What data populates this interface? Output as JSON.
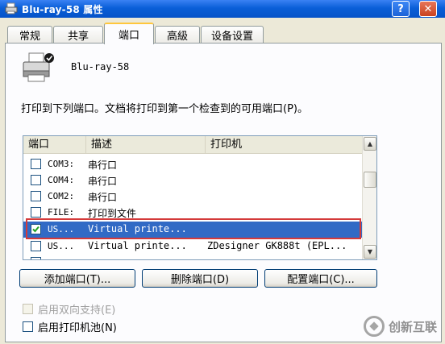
{
  "window": {
    "title": "Blu-ray-58 属性",
    "help": "?",
    "close": "✕"
  },
  "tabs": [
    {
      "label": "常规"
    },
    {
      "label": "共享"
    },
    {
      "label": "端口"
    },
    {
      "label": "高級"
    },
    {
      "label": "设备设置"
    }
  ],
  "printer_name": "Blu-ray-58",
  "instruction": "打印到下列端口。文档将打印到第一个检查到的可用端口(P)。",
  "list": {
    "headers": {
      "port": "端口",
      "desc": "描述",
      "printer": "打印机"
    },
    "rows": [
      {
        "port": "COM3:",
        "desc": "串行口",
        "printer": "",
        "checked": false
      },
      {
        "port": "COM4:",
        "desc": "串行口",
        "printer": "",
        "checked": false
      },
      {
        "port": "COM2:",
        "desc": "串行口",
        "printer": "",
        "checked": false
      },
      {
        "port": "FILE:",
        "desc": "打印到文件",
        "printer": "",
        "checked": false
      },
      {
        "port": "US...",
        "desc": "Virtual printe...",
        "printer": "",
        "checked": true
      },
      {
        "port": "US...",
        "desc": "Virtual printe...",
        "printer": "ZDesigner GK888t (EPL...",
        "checked": false
      }
    ]
  },
  "buttons": {
    "add": "添加端口(T)...",
    "delete": "删除端口(D)",
    "configure": "配置端口(C)..."
  },
  "options": {
    "bidirectional": "启用双向支持(E)",
    "pooling": "启用打印机池(N)"
  },
  "watermark": {
    "text": "创新互联"
  },
  "colors": {
    "selection": "#316ac5",
    "highlight_box": "#d43a3a",
    "titlebar": "#0a5fd8"
  }
}
